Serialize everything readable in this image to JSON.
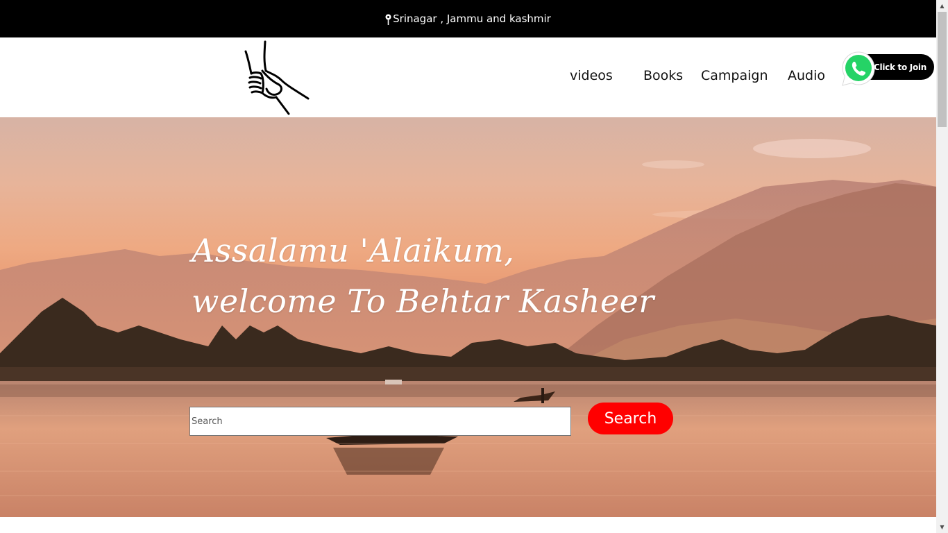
{
  "topbar": {
    "location": "Srinagar , Jammu and kashmir",
    "icon": "map-pin-icon"
  },
  "header": {
    "logo": "helping-hands-logo",
    "nav": [
      {
        "label": "videos"
      },
      {
        "label": "Books"
      },
      {
        "label": "Campaign"
      },
      {
        "label": "Audio"
      }
    ],
    "whatsapp": {
      "label": "Click to Join",
      "icon": "whatsapp-icon",
      "color": "#25d366"
    }
  },
  "hero": {
    "greeting_line1": "Assalamu 'Alaikum,",
    "greeting_line2": "welcome To Behtar Kasheer",
    "search": {
      "placeholder": "Search",
      "value": "",
      "button_label": "Search"
    }
  },
  "colors": {
    "topbar_bg": "#000000",
    "accent": "#ff0000",
    "hero_sky": "#e9a98a"
  }
}
